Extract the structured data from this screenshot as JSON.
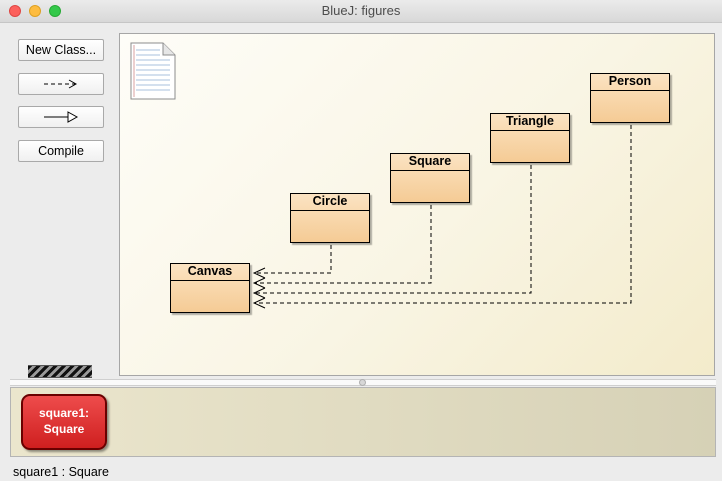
{
  "window": {
    "title": "BlueJ:  figures"
  },
  "toolbar": {
    "new_class_label": "New Class...",
    "dependency_arrow_icon": "dashed-arrow-icon",
    "inheritance_arrow_icon": "hollow-arrow-icon",
    "compile_label": "Compile"
  },
  "diagram": {
    "readme_icon": "document-icon",
    "classes": [
      "Canvas",
      "Circle",
      "Square",
      "Triangle",
      "Person"
    ],
    "dependencies": [
      {
        "from": "Circle",
        "to": "Canvas"
      },
      {
        "from": "Square",
        "to": "Canvas"
      },
      {
        "from": "Triangle",
        "to": "Canvas"
      },
      {
        "from": "Person",
        "to": "Canvas"
      }
    ]
  },
  "object_bench": {
    "objects": [
      {
        "line1": "square1:",
        "line2": "Square"
      }
    ]
  },
  "status_text": "square1 : Square",
  "colors": {
    "class_fill": "#f5cb95",
    "diagram_bg": "#f9f5e4",
    "object_fill": "#d82a2a"
  }
}
